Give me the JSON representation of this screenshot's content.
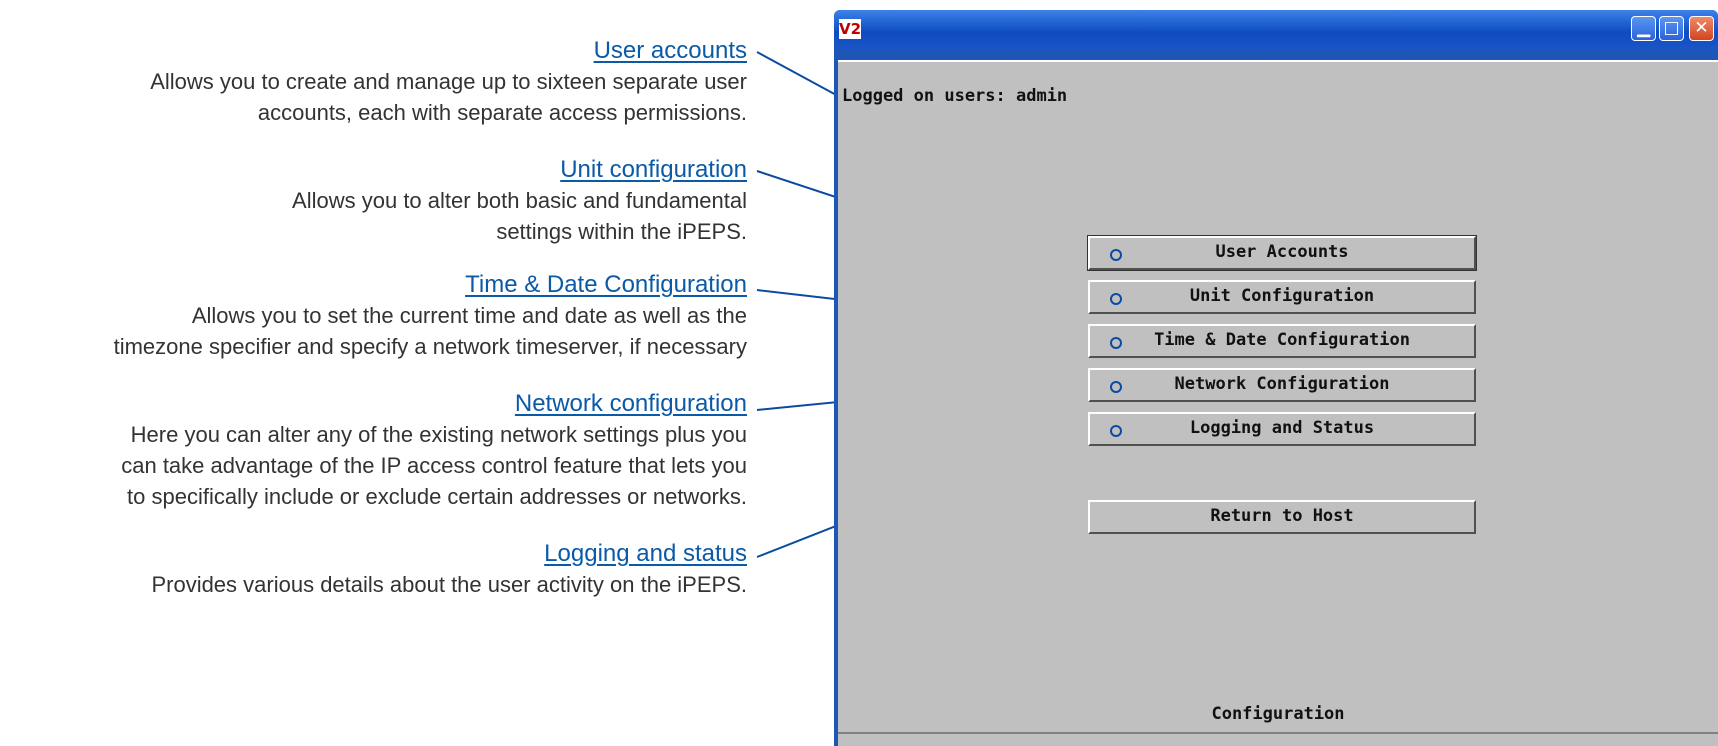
{
  "annotations": [
    {
      "title": "User accounts",
      "desc": "Allows you to create and manage up to sixteen separate user\naccounts, each with separate access permissions."
    },
    {
      "title": "Unit configuration",
      "desc": "Allows you to alter both basic and fundamental\nsettings within the iPEPS."
    },
    {
      "title": "Time & Date Configuration",
      "desc": "Allows you to set the current time and date as well as the\ntimezone specifier and specify a network timeserver, if necessary"
    },
    {
      "title": "Network configuration",
      "desc": "Here you can alter any of the existing network settings plus you\ncan take advantage of the IP access control feature that lets you\nto specifically include or exclude certain addresses or networks."
    },
    {
      "title": "Logging and status",
      "desc": "Provides various details about the user activity on the iPEPS."
    }
  ],
  "window": {
    "icon_text": "V2",
    "logged_on": "Logged on users:  admin",
    "menu": [
      "User Accounts",
      "Unit Configuration",
      "Time & Date Configuration",
      "Network Configuration",
      "Logging and Status"
    ],
    "return_label": "Return to Host",
    "footer_label": "Configuration"
  },
  "colors": {
    "accent": "#0a5aa8",
    "client_bg": "#c0c0c0",
    "titlebar": "#1a56c6"
  },
  "icons": [
    "minimize-icon",
    "maximize-icon",
    "close-icon",
    "radio-dot-icon"
  ]
}
